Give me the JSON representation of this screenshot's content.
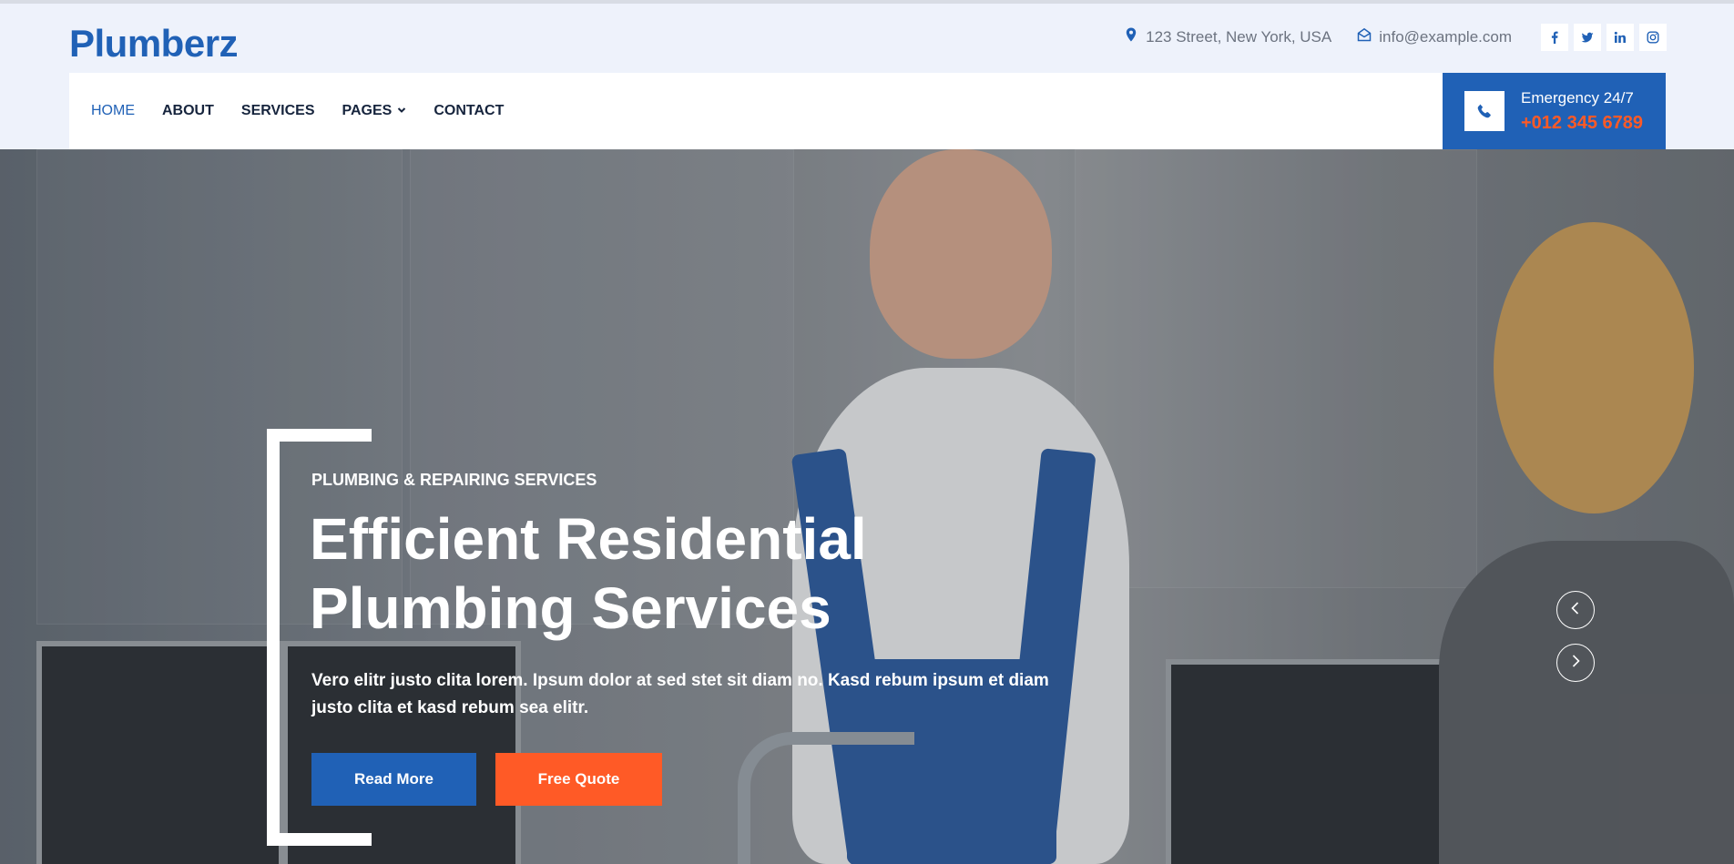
{
  "brand": {
    "name": "Plumberz"
  },
  "topbar": {
    "address": "123 Street, New York, USA",
    "email": "info@example.com",
    "socials": [
      {
        "icon": "facebook-icon",
        "label": "f"
      },
      {
        "icon": "twitter-icon",
        "label": ""
      },
      {
        "icon": "linkedin-icon",
        "label": "in"
      },
      {
        "icon": "instagram-icon",
        "label": ""
      }
    ]
  },
  "nav": {
    "items": [
      {
        "label": "HOME",
        "active": true
      },
      {
        "label": "ABOUT",
        "active": false
      },
      {
        "label": "SERVICES",
        "active": false
      },
      {
        "label": "PAGES",
        "active": false,
        "dropdown": true
      },
      {
        "label": "CONTACT",
        "active": false
      }
    ]
  },
  "emergency": {
    "label": "Emergency 24/7",
    "phone": "+012 345 6789"
  },
  "hero": {
    "tagline": "PLUMBING & REPAIRING SERVICES",
    "headline": "Efficient Residential Plumbing Services",
    "description": "Vero elitr justo clita lorem. Ipsum dolor at sed stet sit diam no. Kasd rebum ipsum et diam justo clita et kasd rebum sea elitr.",
    "primary_button": "Read More",
    "secondary_button": "Free Quote"
  },
  "colors": {
    "primary": "#2061b6",
    "accent": "#ff5a26",
    "topbar_bg": "#eef2fb"
  }
}
